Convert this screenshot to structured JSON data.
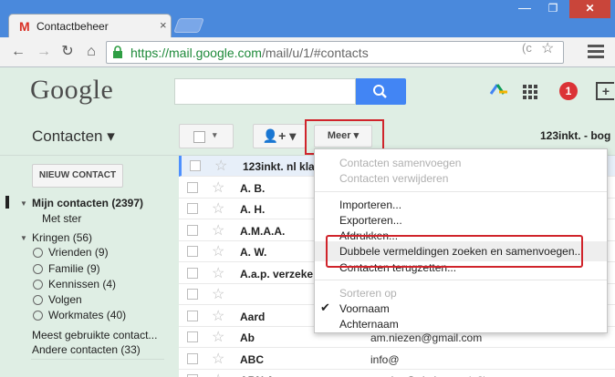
{
  "browser": {
    "tab_title": "Contactbeheer",
    "tab_close": "×",
    "gmail_glyph": "M",
    "window_min": "—",
    "window_max": "❐",
    "window_close": "✕",
    "url_secure": "https://mail.google.com",
    "url_rest": "/mail/u/1/#contacts",
    "ext_glyph": "(c",
    "star_glyph": "☆"
  },
  "header": {
    "logo": "Google",
    "search_placeholder": "",
    "notification_count": "1",
    "share_glyph": "+"
  },
  "subheader": {
    "app_title": "Contacten ▾",
    "select_arrow": "▾",
    "add_user_glyph": "👤+ ▾",
    "more_label": "Meer ▾",
    "account_label": "123inkt. - bog"
  },
  "sidebar": {
    "new_contact": "NIEUW CONTACT",
    "my_contacts": "Mijn contacten (2397)",
    "starred": "Met ster",
    "circles": "Kringen (56)",
    "circle_items": [
      "Vrienden (9)",
      "Familie (9)",
      "Kennissen (4)",
      "Volgen",
      "Workmates (40)"
    ],
    "most_used": "Meest gebruikte contact...",
    "other_contacts": "Andere contacten (33)"
  },
  "contacts": {
    "rows": [
      {
        "name": "123inkt. nl kla",
        "email": "",
        "extra": ""
      },
      {
        "name": "A. B.",
        "email": "",
        "extra": ""
      },
      {
        "name": "A. H.",
        "email": "n",
        "extra": ""
      },
      {
        "name": "A.M.A.A.",
        "email": "",
        "extra": ""
      },
      {
        "name": "A. W.",
        "email": "",
        "extra": ""
      },
      {
        "name": "A.a.p. verzeke",
        "email": "",
        "extra": ""
      },
      {
        "name": "",
        "email": "",
        "extra": ""
      },
      {
        "name": "Aard",
        "email": "o",
        "extra": ""
      },
      {
        "name": "Ab",
        "email": "am.niezen@gmail.com",
        "extra": ""
      },
      {
        "name": "ABC",
        "email": "info@",
        "extra": ""
      },
      {
        "name": "ABN Amro",
        "email": "service@nl.abna...",
        "extra": "(+3)"
      }
    ]
  },
  "menu": {
    "merge_contacts": "Contacten samenvoegen",
    "delete_contacts": "Contacten verwijderen",
    "import": "Importeren...",
    "export": "Exporteren...",
    "print": "Afdrukken...",
    "find_duplicates": "Dubbele vermeldingen zoeken en samenvoegen...",
    "restore": "Contacten terugzetten...",
    "sort_by": "Sorteren op",
    "first_name": "Voornaam",
    "last_name": "Achternaam",
    "check": "✔"
  },
  "colors": {
    "accent": "#4285f4",
    "highlight": "#d0242b",
    "background": "#dfeee4"
  }
}
